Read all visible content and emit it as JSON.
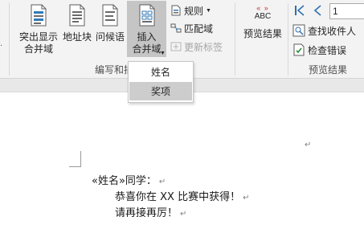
{
  "ribbon": {
    "write_insert": {
      "highlight_merge_fields": "突出显示\n合并域",
      "address_block": "地址块",
      "greeting_line": "问候语",
      "insert_merge_field": "插入\n合并域",
      "rules": "规则",
      "match_fields": "匹配域",
      "update_labels": "更新标签",
      "group_label": "编写和插"
    },
    "preview": {
      "abc_label": "ABC",
      "preview_results": "预览结果",
      "record_number": "1",
      "find_recipient": "查找收件人",
      "check_errors": "检查错误",
      "group_label": "预览结果"
    }
  },
  "dropdown": {
    "items": [
      {
        "label": "姓名"
      },
      {
        "label": "奖项"
      }
    ]
  },
  "document": {
    "line1": "«姓名»同学：",
    "line2": "恭喜你在 XX 比赛中获得！",
    "line3": "请再接再厉！",
    "para_mark": "↵"
  }
}
